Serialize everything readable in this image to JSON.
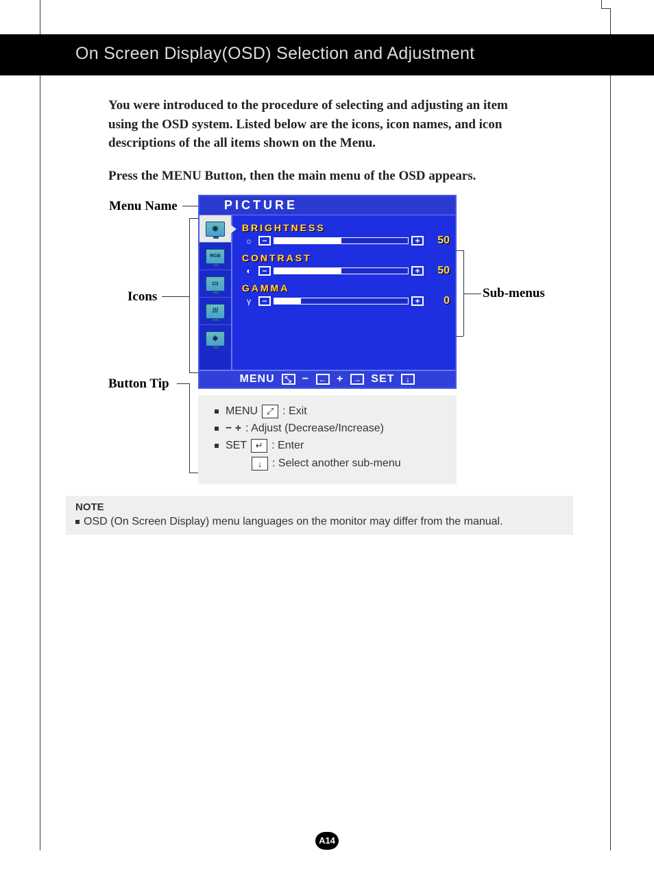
{
  "header": {
    "title": "On Screen Display(OSD) Selection and Adjustment"
  },
  "intro": "You were introduced to the procedure of selecting and adjusting an item using the OSD system.  Listed below are the icons, icon names, and icon descriptions of the all items shown on the Menu.",
  "press_line": "Press the MENU Button, then the main menu of the OSD appears.",
  "labels": {
    "menu_name": "Menu Name",
    "icons": "Icons",
    "button_tip": "Button Tip",
    "sub_menus": "Sub-menus"
  },
  "osd": {
    "title": "PICTURE",
    "icons": [
      "picture",
      "rgb",
      "screen",
      "tools",
      "setup"
    ],
    "submenus": [
      {
        "name": "BRIGHTNESS",
        "symbol": "☼",
        "value": 50,
        "percent": 50
      },
      {
        "name": "CONTRAST",
        "symbol": "◐",
        "value": 50,
        "percent": 50
      },
      {
        "name": "GAMMA",
        "symbol": "γ",
        "value": 0,
        "percent": 20
      }
    ],
    "footer": {
      "menu": "MENU",
      "menu_glyph": "⤡",
      "minus": "−",
      "minus_glyph": "←",
      "plus": "+",
      "plus_glyph": "→",
      "set": "SET",
      "set_glyph": "↓"
    }
  },
  "tips": {
    "rows": [
      {
        "label": "MENU",
        "glyph": "⤢",
        "desc": ": Exit"
      },
      {
        "label": "−   +",
        "glyph": "",
        "desc": ": Adjust (Decrease/Increase)"
      },
      {
        "label": "SET",
        "glyph": "↵",
        "desc": ": Enter"
      },
      {
        "label": "",
        "glyph": "↓",
        "desc": ": Select another sub-menu"
      }
    ]
  },
  "note": {
    "label": "NOTE",
    "text": "OSD (On Screen Display) menu languages on the monitor may differ from the manual."
  },
  "page_number": "A14"
}
